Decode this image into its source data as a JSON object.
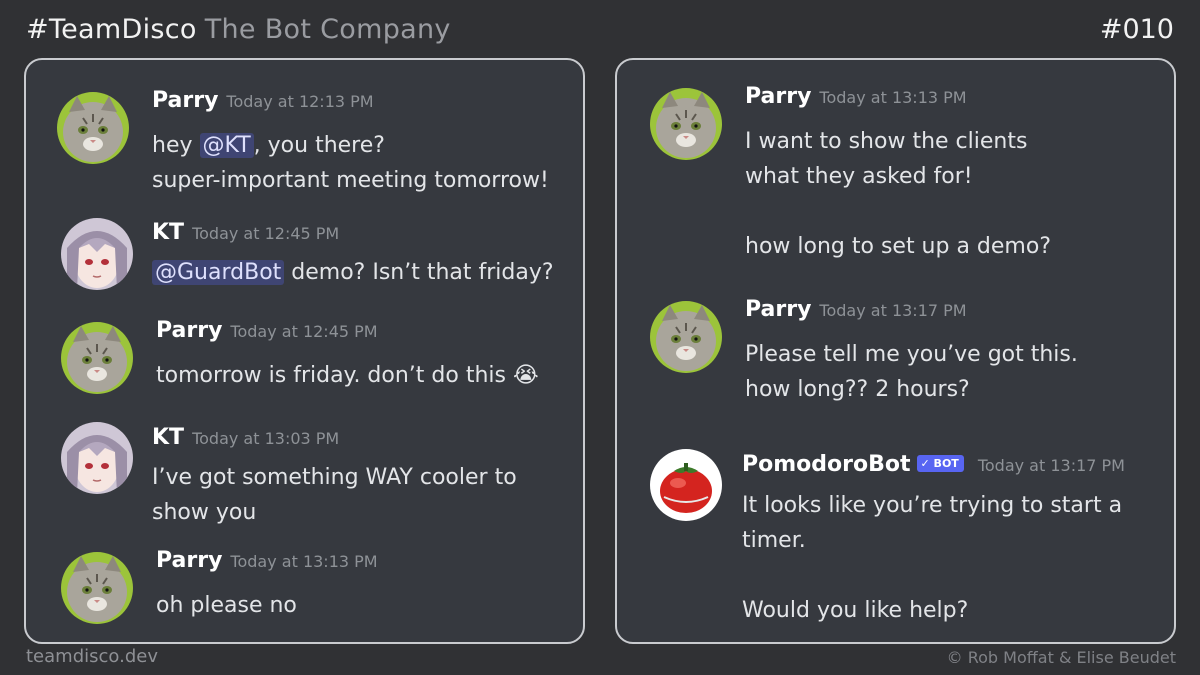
{
  "header": {
    "brand": "#TeamDisco",
    "subtitle": "The Bot Company",
    "episode": "#010"
  },
  "footer": {
    "site": "teamdisco.dev",
    "credit": "© Rob Moffat & Elise Beudet"
  },
  "left_panel": {
    "m1": {
      "author": "Parry",
      "time": "Today at 12:13 PM",
      "pre": "hey ",
      "mention": "@KT",
      "post": ", you there?",
      "line2": "super-important meeting tomorrow!"
    },
    "m2": {
      "author": "KT",
      "time": "Today at 12:45 PM",
      "mention": "@GuardBot",
      "post": " demo?  Isn’t that friday?"
    },
    "m3": {
      "author": "Parry",
      "time": "Today at 12:45 PM",
      "text": "tomorrow is friday. don’t do this",
      "emoji": "😭"
    },
    "m4": {
      "author": "KT",
      "time": "Today at 13:03 PM",
      "line1": "I’ve got something WAY cooler to",
      "line2": "show you"
    },
    "m5": {
      "author": "Parry",
      "time": "Today at 13:13 PM",
      "text": "oh please no"
    }
  },
  "right_panel": {
    "m1": {
      "author": "Parry",
      "time": "Today at 13:13 PM",
      "line1": "I want to show the clients",
      "line2": "what they asked for!",
      "line3": "how long to set up a demo?"
    },
    "m2": {
      "author": "Parry",
      "time": "Today at 13:17 PM",
      "line1": "Please tell me you’ve got this.",
      "line2": "how long?? 2 hours?"
    },
    "m3": {
      "author": "PomodoroBot",
      "badge": "✓ BOT",
      "time": "Today at 13:17 PM",
      "line1": "It looks like you’re trying to start a",
      "line2": "timer.",
      "line3": "Would you like help?"
    }
  }
}
